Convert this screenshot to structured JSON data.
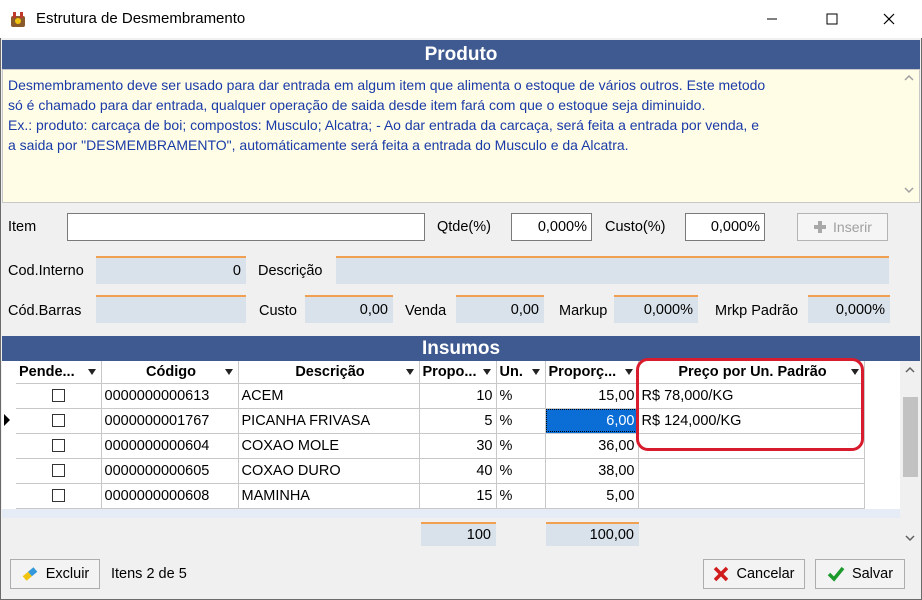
{
  "window": {
    "title": "Estrutura de Desmembramento"
  },
  "produto": {
    "header": "Produto",
    "description_lines": [
      "Desmembramento deve ser usado para dar entrada em algum item que alimenta o estoque de vários outros. Este metodo",
      "só é chamado para dar entrada, qualquer operação de saida desde item fará com que o estoque seja diminuido.",
      "Ex.: produto: carcaça de boi; compostos: Musculo; Alcatra; - Ao dar entrada da carcaça, será feita a entrada por venda, e",
      "a saida por \"DESMEMBRAMENTO\", automáticamente será feita a entrada do Musculo e da Alcatra."
    ]
  },
  "form": {
    "item_label": "Item",
    "item_value": "",
    "qtde_label": "Qtde(%)",
    "qtde_value": "0,000%",
    "custo_pct_label": "Custo(%)",
    "custo_pct_value": "0,000%",
    "inserir_label": "Inserir",
    "cod_interno_label": "Cod.Interno",
    "cod_interno_value": "0",
    "descricao_label": "Descrição",
    "descricao_value": "",
    "cod_barras_label": "Cód.Barras",
    "cod_barras_value": "",
    "custo_label": "Custo",
    "custo_value": "0,00",
    "venda_label": "Venda",
    "venda_value": "0,00",
    "markup_label": "Markup",
    "markup_value": "0,000%",
    "mrkp_padrao_label": "Mrkp Padrão",
    "mrkp_padrao_value": "0,000%"
  },
  "insumos": {
    "header": "Insumos",
    "columns": [
      "Pende...",
      "Código",
      "Descrição",
      "Propo...",
      "Un.",
      "Proporç...",
      "Preço por Un. Padrão"
    ],
    "rows": [
      {
        "codigo": "0000000000613",
        "descricao": "ACEM",
        "propo": "10",
        "un": "%",
        "proporc": "15,00",
        "preco": "R$ 78,000/KG"
      },
      {
        "codigo": "0000000001767",
        "descricao": "PICANHA FRIVASA",
        "propo": "5",
        "un": "%",
        "proporc": "6,00",
        "preco": "R$ 124,000/KG"
      },
      {
        "codigo": "0000000000604",
        "descricao": "COXAO MOLE",
        "propo": "30",
        "un": "%",
        "proporc": "36,00",
        "preco": ""
      },
      {
        "codigo": "0000000000605",
        "descricao": "COXAO DURO",
        "propo": "40",
        "un": "%",
        "proporc": "38,00",
        "preco": ""
      },
      {
        "codigo": "0000000000608",
        "descricao": "MAMINHA",
        "propo": "15",
        "un": "%",
        "proporc": "5,00",
        "preco": ""
      }
    ],
    "total_propo": "100",
    "total_proporc": "100,00"
  },
  "footer": {
    "excluir_label": "Excluir",
    "itens_status": "Itens 2 de 5",
    "cancelar_label": "Cancelar",
    "salvar_label": "Salvar"
  },
  "colors": {
    "header_bg": "#3f5a91",
    "desc_text": "#1a3aa8",
    "selected": "#0a6ed6",
    "highlight": "#d81c2e"
  }
}
